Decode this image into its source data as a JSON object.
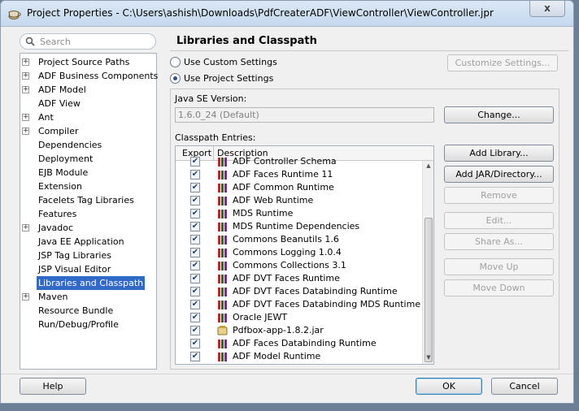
{
  "window": {
    "title": "Project Properties - C:\\Users\\ashish\\Downloads\\PdfCreaterADF\\ViewController\\ViewController.jpr",
    "close_label": "x"
  },
  "navigator": {
    "search_placeholder": "Search",
    "items": [
      {
        "label": "Project Source Paths",
        "expandable": true
      },
      {
        "label": "ADF Business Components",
        "expandable": true
      },
      {
        "label": "ADF Model",
        "expandable": true
      },
      {
        "label": "ADF View",
        "expandable": false
      },
      {
        "label": "Ant",
        "expandable": true
      },
      {
        "label": "Compiler",
        "expandable": true
      },
      {
        "label": "Dependencies",
        "expandable": false
      },
      {
        "label": "Deployment",
        "expandable": false
      },
      {
        "label": "EJB Module",
        "expandable": false
      },
      {
        "label": "Extension",
        "expandable": false
      },
      {
        "label": "Facelets Tag Libraries",
        "expandable": false
      },
      {
        "label": "Features",
        "expandable": false
      },
      {
        "label": "Javadoc",
        "expandable": true
      },
      {
        "label": "Java EE Application",
        "expandable": false
      },
      {
        "label": "JSP Tag Libraries",
        "expandable": false
      },
      {
        "label": "JSP Visual Editor",
        "expandable": false
      },
      {
        "label": "Libraries and Classpath",
        "expandable": false,
        "selected": true
      },
      {
        "label": "Maven",
        "expandable": true
      },
      {
        "label": "Resource Bundle",
        "expandable": false
      },
      {
        "label": "Run/Debug/Profile",
        "expandable": false
      }
    ],
    "expand_symbol": "+"
  },
  "panel": {
    "title": "Libraries and Classpath",
    "use_custom_label": "Use Custom Settings",
    "use_project_label": "Use Project Settings",
    "selected_setting": "Use Project Settings",
    "customize_label": "Customize Settings...",
    "java_se_label": "Java SE Version:",
    "java_se_value": "1.6.0_24 (Default)",
    "change_label": "Change...",
    "classpath_label": "Classpath Entries:",
    "col_export": "Export",
    "col_description": "Description",
    "partial_top_entry": "ADF Controller Schema",
    "entries": [
      {
        "name": "ADF Faces Runtime 11",
        "checked": true,
        "icon": "library-icon"
      },
      {
        "name": "ADF Common Runtime",
        "checked": true,
        "icon": "library-icon"
      },
      {
        "name": "ADF Web Runtime",
        "checked": true,
        "icon": "library-icon"
      },
      {
        "name": "MDS Runtime",
        "checked": true,
        "icon": "library-icon"
      },
      {
        "name": "MDS Runtime Dependencies",
        "checked": true,
        "icon": "library-icon"
      },
      {
        "name": "Commons Beanutils 1.6",
        "checked": true,
        "icon": "library-icon"
      },
      {
        "name": "Commons Logging 1.0.4",
        "checked": true,
        "icon": "library-icon"
      },
      {
        "name": "Commons Collections 3.1",
        "checked": true,
        "icon": "library-icon"
      },
      {
        "name": "ADF DVT Faces Runtime",
        "checked": true,
        "icon": "library-icon"
      },
      {
        "name": "ADF DVT Faces Databinding Runtime",
        "checked": true,
        "icon": "library-icon"
      },
      {
        "name": "ADF DVT Faces Databinding MDS Runtime",
        "checked": true,
        "icon": "library-icon"
      },
      {
        "name": "Oracle JEWT",
        "checked": true,
        "icon": "library-icon"
      },
      {
        "name": "Pdfbox-app-1.8.2.jar",
        "checked": true,
        "icon": "jar-icon"
      },
      {
        "name": "ADF Faces Databinding Runtime",
        "checked": true,
        "icon": "library-icon"
      },
      {
        "name": "ADF Model Runtime",
        "checked": true,
        "icon": "library-icon"
      }
    ],
    "buttons": {
      "add_library": "Add Library...",
      "add_jar": "Add JAR/Directory...",
      "remove": "Remove",
      "edit": "Edit...",
      "share_as": "Share As...",
      "move_up": "Move Up",
      "move_down": "Move Down"
    }
  },
  "footer": {
    "help": "Help",
    "ok": "OK",
    "cancel": "Cancel"
  },
  "colors": {
    "selection": "#3169c6",
    "library_icon": "#b52a2a",
    "checkbox_tick": "#21406d"
  }
}
